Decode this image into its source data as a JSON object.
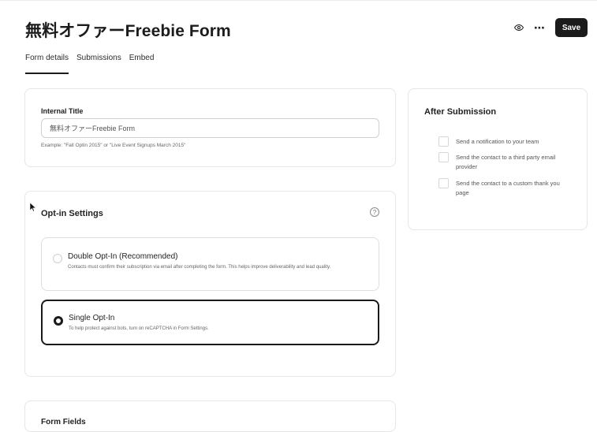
{
  "header": {
    "title": "無料オファーFreebie Form",
    "save_label": "Save",
    "icons": [
      "eye-icon",
      "more-icon"
    ]
  },
  "tabs": [
    {
      "label": "Form details",
      "active": true
    },
    {
      "label": "Submissions",
      "active": false
    },
    {
      "label": "Embed",
      "active": false
    }
  ],
  "internal_title": {
    "label": "Internal Title",
    "value": "無料オファーFreebie Form",
    "hint": "Example: \"Fall Optin 2015\" or \"Live Event Signups March 2015\""
  },
  "optin": {
    "title": "Opt-in Settings",
    "help_glyph": "?",
    "options": [
      {
        "title": "Double Opt-In (Recommended)",
        "description": "Contacts must confirm their subscription via email after completing the form. This helps improve deliverability and lead quality.",
        "selected": false
      },
      {
        "title": "Single Opt-In",
        "description": "To help protect against bots, turn on reCAPTCHA in Form Settings.",
        "selected": true
      }
    ]
  },
  "after_submission": {
    "title": "After Submission",
    "items": [
      {
        "label": "Send a notification to your team",
        "checked": false
      },
      {
        "label": "Send the contact to a third party email provider",
        "checked": false
      },
      {
        "label": "Send the contact to a custom thank you page",
        "checked": false
      }
    ]
  },
  "form_fields": {
    "title": "Form Fields"
  },
  "colors": {
    "text": "#1f1f1f",
    "border": "#e6e6e6",
    "button_bg": "#1b1b1b",
    "button_text": "#ffffff",
    "muted": "#666666"
  }
}
